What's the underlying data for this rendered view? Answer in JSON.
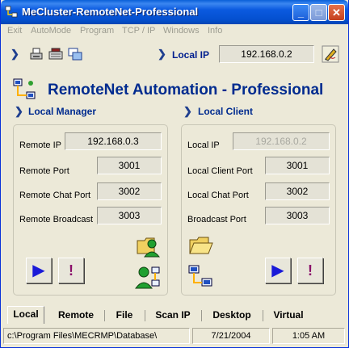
{
  "window": {
    "title": "MeCluster-RemoteNet-Professional",
    "minimize_symbol": "_",
    "maximize_symbol": "□",
    "close_symbol": "✕"
  },
  "menu": [
    "Exit",
    "AutoMode",
    "Program",
    "TCP / IP",
    "Windows",
    "Info"
  ],
  "toolbar": {
    "arrow": "❯",
    "local_ip_label": "Local IP",
    "local_ip_value": "192.168.0.2",
    "icons": [
      "printer-icon",
      "keyboard-icon",
      "copy-windows-icon",
      "edit-pencil-icon"
    ]
  },
  "header": {
    "title": "RemoteNet Automation - Professional"
  },
  "local_manager": {
    "heading": "Local Manager",
    "remote_ip_label": "Remote IP",
    "remote_ip_value": "192.168.0.3",
    "remote_port_label": "Remote Port",
    "remote_port_value": "3001",
    "remote_chat_port_label": "Remote Chat Port",
    "remote_chat_port_value": "3002",
    "remote_broadcast_label": "Remote Broadcast",
    "remote_broadcast_value": "3003",
    "play_symbol": "▶",
    "alert_symbol": "!"
  },
  "local_client": {
    "heading": "Local Client",
    "local_ip_label": "Local IP",
    "local_ip_value": "192.168.0.2",
    "local_client_port_label": "Local Client Port",
    "local_client_port_value": "3001",
    "local_chat_port_label": "Local Chat Port",
    "local_chat_port_value": "3002",
    "broadcast_port_label": "Broadcast Port",
    "broadcast_port_value": "3003",
    "play_symbol": "▶",
    "alert_symbol": "!"
  },
  "tabs": [
    {
      "label": "Local",
      "active": true
    },
    {
      "label": "Remote",
      "active": false
    },
    {
      "label": "File",
      "active": false
    },
    {
      "label": "Scan IP",
      "active": false
    },
    {
      "label": "Desktop",
      "active": false
    },
    {
      "label": "Virtual",
      "active": false
    }
  ],
  "status": {
    "path": "c:\\Program Files\\MECRMP\\Database\\",
    "date": "7/21/2004",
    "time": "1:05 AM"
  },
  "colors": {
    "title_blue": "#0450d0",
    "heading_navy": "#002b8f",
    "play_blue": "#1a1ad8",
    "alert_purple": "#8a0f6a",
    "window_bg": "#ece9d8"
  }
}
